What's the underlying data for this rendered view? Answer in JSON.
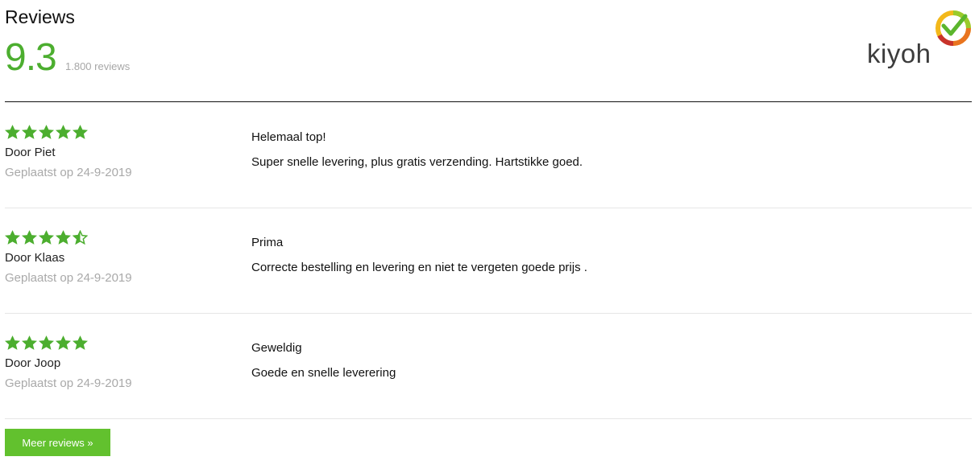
{
  "header": {
    "title": "Reviews",
    "score": "9.3",
    "review_count": "1.800 reviews",
    "logo_text": "kiyoh",
    "logo_icon": "kiyoh-checkmark-logo"
  },
  "colors": {
    "accent_green": "#4cae2f",
    "button_green": "#62c12e",
    "muted_gray": "#a9a9a9"
  },
  "reviews": [
    {
      "rating": 5,
      "author": "Door Piet",
      "date": "Geplaatst op 24-9-2019",
      "title": "Helemaal top!",
      "text": "Super snelle levering, plus gratis verzending. Hartstikke goed."
    },
    {
      "rating": 4.5,
      "author": "Door Klaas",
      "date": "Geplaatst op 24-9-2019",
      "title": "Prima",
      "text": "Correcte bestelling en levering en niet te vergeten goede prijs ."
    },
    {
      "rating": 5,
      "author": "Door Joop",
      "date": "Geplaatst op 24-9-2019",
      "title": "Geweldig",
      "text": "Goede en snelle leverering"
    }
  ],
  "more_button": {
    "label": "Meer reviews »"
  }
}
